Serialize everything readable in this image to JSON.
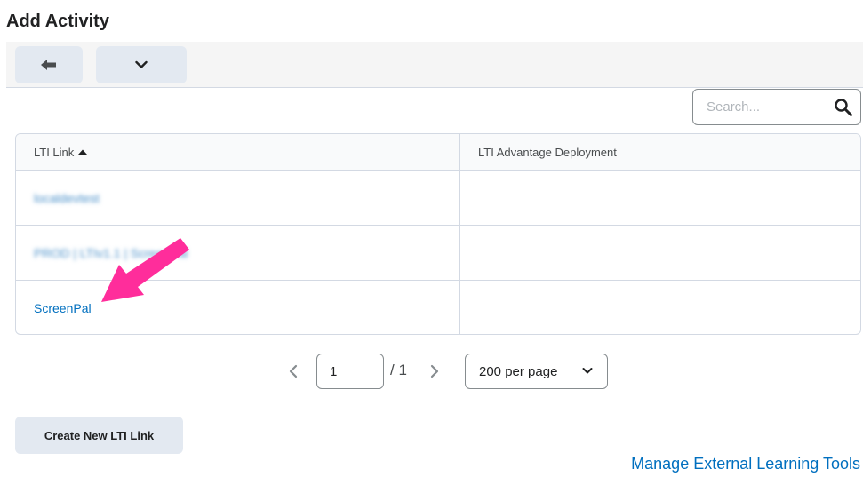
{
  "page": {
    "title": "Add Activity"
  },
  "toolbar": {
    "back_icon": "back-arrow-icon",
    "more_icon": "chevron-down-icon"
  },
  "search": {
    "placeholder": "Search...",
    "icon": "search-icon"
  },
  "table": {
    "columns": [
      {
        "label": "LTI Link",
        "sort": "ascending"
      },
      {
        "label": "LTI Advantage Deployment"
      }
    ],
    "rows": [
      {
        "link": "localdevtest",
        "deployment": ""
      },
      {
        "link": "PROD | LTIv1.1 | ScreenPal",
        "deployment": ""
      },
      {
        "link": "ScreenPal",
        "deployment": ""
      }
    ]
  },
  "pagination": {
    "current_page": "1",
    "total_label": "/ 1",
    "page_size_label": "200 per page"
  },
  "actions": {
    "create_label": "Create New LTI Link",
    "manage_label": "Manage External Learning Tools"
  },
  "colors": {
    "link": "#006fbf",
    "button_bg": "#e3e9f1",
    "annotation_arrow": "#ff2d9b"
  }
}
